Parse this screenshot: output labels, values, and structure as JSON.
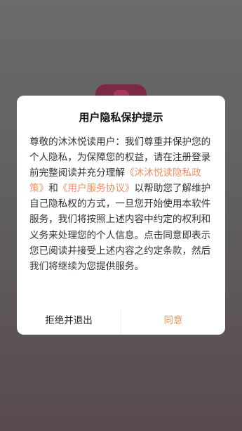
{
  "dialog": {
    "title": "用户隐私保护提示",
    "body": {
      "part1": "尊敬的沐沐悦读用户：我们尊重并保护您的个人隐私，为保障您的权益，请在注册登录前完整阅读并充分理解",
      "privacy_link": "《沐沐悦读隐私政策》",
      "and_text": "和",
      "agreement_link": "《用户服务协议》",
      "part2": "以帮助您了解维护自己隐私权的方式，一旦您开始使用本软件服务，我们将按照上述内容中约定的权利和义务来处理您的个人信息。点击同意即表示您已阅读并接受上述内容之约定条款，然后我们将继续为您提供服务。"
    },
    "buttons": {
      "reject": "拒绝并退出",
      "agree": "同意"
    }
  },
  "colors": {
    "accent": "#f09062",
    "overlay": "#5f5c5d",
    "logo": "#7a2a46"
  }
}
